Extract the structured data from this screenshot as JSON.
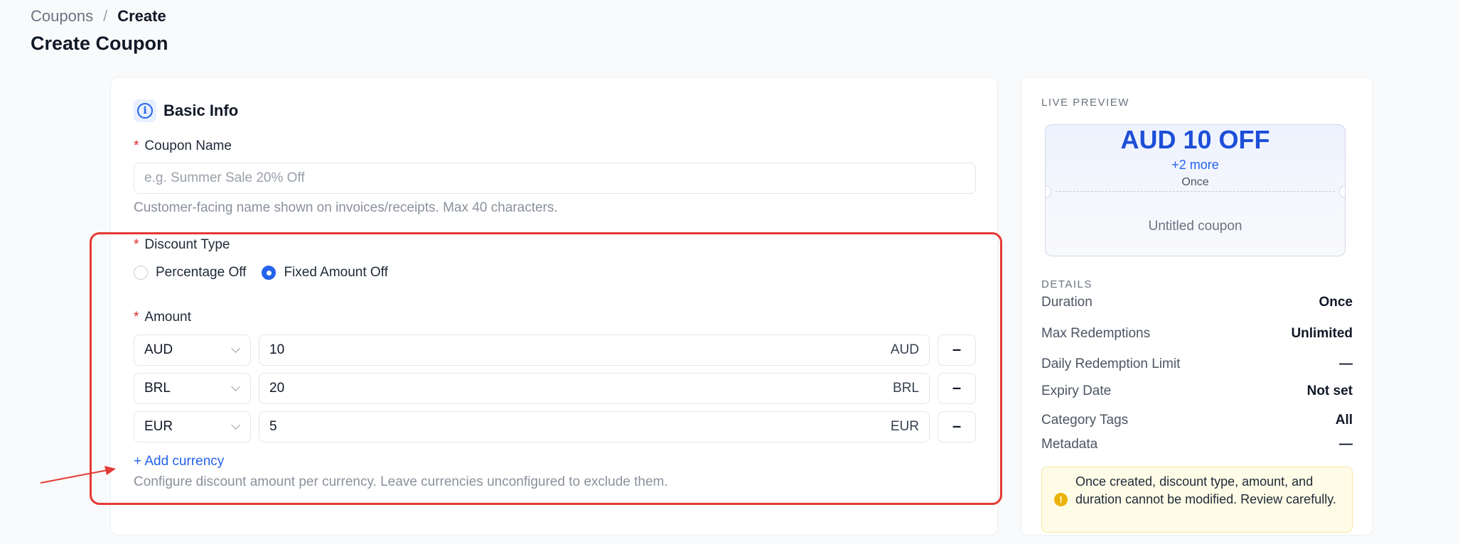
{
  "breadcrumb": {
    "parent": "Coupons",
    "separator": "/",
    "current": "Create"
  },
  "page_title": "Create Coupon",
  "basic_info": {
    "title": "Basic Info",
    "coupon_name": {
      "label": "Coupon Name",
      "required_mark": "*",
      "value": "",
      "placeholder": "e.g. Summer Sale 20% Off",
      "help": "Customer-facing name shown on invoices/receipts. Max 40 characters."
    },
    "discount_type": {
      "label": "Discount Type",
      "required_mark": "*",
      "options": [
        {
          "label": "Percentage Off",
          "checked": false
        },
        {
          "label": "Fixed Amount Off",
          "checked": true
        }
      ]
    },
    "amount": {
      "label": "Amount",
      "required_mark": "*",
      "rows": [
        {
          "currency": "AUD",
          "value": "10",
          "suffix": "AUD",
          "remove": "–"
        },
        {
          "currency": "BRL",
          "value": "20",
          "suffix": "BRL",
          "remove": "–"
        },
        {
          "currency": "EUR",
          "value": "5",
          "suffix": "EUR",
          "remove": "–"
        }
      ],
      "add_currency": "+ Add currency",
      "help": "Configure discount amount per currency. Leave currencies unconfigured to exclude them."
    }
  },
  "preview": {
    "caption": "LIVE PREVIEW",
    "amount": "AUD 10 OFF",
    "more": "+2 more",
    "frequency": "Once",
    "name": "Untitled coupon",
    "details_caption": "DETAILS",
    "details": [
      {
        "key": "Duration",
        "value": "Once"
      },
      {
        "key": "Max Redemptions",
        "value": "Unlimited"
      },
      {
        "key": "Daily Redemption Limit",
        "value": "—"
      },
      {
        "key": "Expiry Date",
        "value": "Not set"
      },
      {
        "key": "Category Tags",
        "value": "All"
      },
      {
        "key": "Metadata",
        "value": "—"
      }
    ],
    "warning": "Once created, discount type, amount, and duration cannot be modified. Review carefully.",
    "warning_icon": "!"
  },
  "colors": {
    "accent": "#2563eb",
    "highlight": "#e53935",
    "required": "#dc2626",
    "warning_bg": "#fefbe6"
  }
}
